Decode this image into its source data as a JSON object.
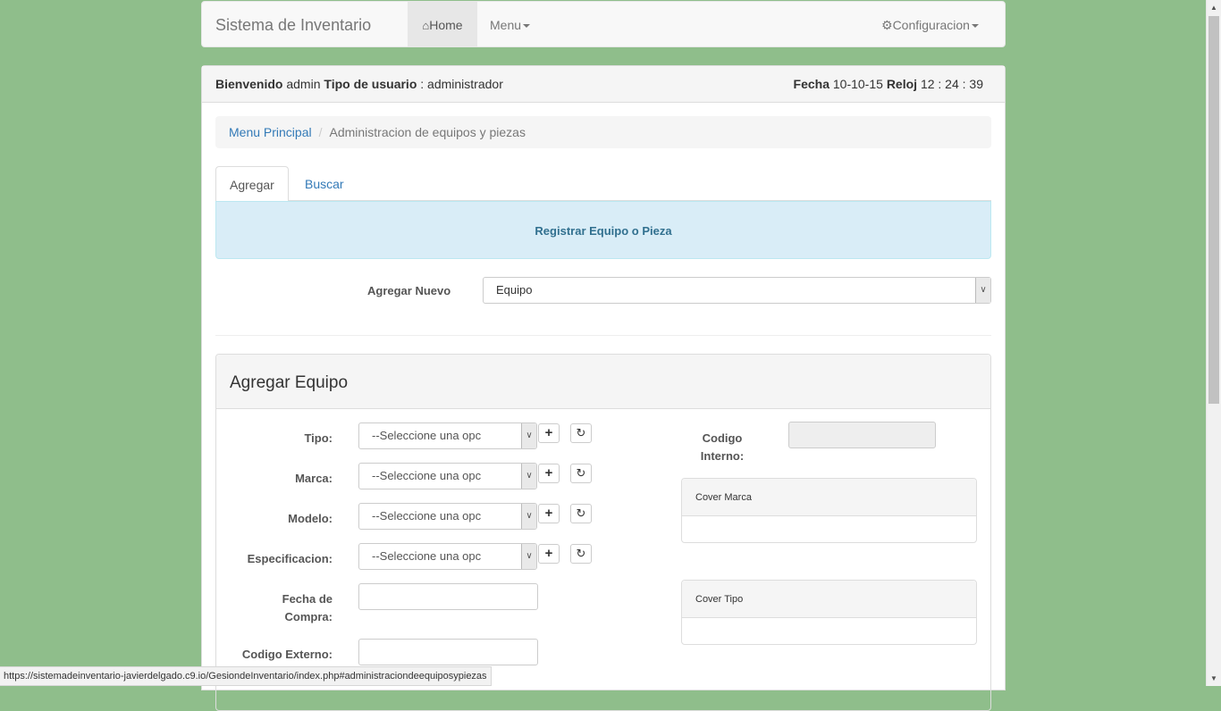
{
  "navbar": {
    "brand": "Sistema de Inventario",
    "home": "Home",
    "menu": "Menu",
    "config": "Configuracion"
  },
  "header": {
    "welcome_label": "Bienvenido",
    "username": "admin",
    "user_type_label": "Tipo de usuario",
    "user_type_sep": ":",
    "user_type": "administrador",
    "date_label": "Fecha",
    "date": "10-10-15",
    "clock_label": "Reloj",
    "clock": "12 : 24 : 39"
  },
  "breadcrumb": {
    "home": "Menu Principal",
    "separator": "/",
    "current": "Administracion de equipos y piezas"
  },
  "tabs": [
    {
      "label": "Agregar",
      "active": true
    },
    {
      "label": "Buscar",
      "active": false
    }
  ],
  "alert": "Registrar Equipo o Pieza",
  "agregar_nuevo": {
    "label": "Agregar Nuevo",
    "value": "Equipo"
  },
  "form": {
    "title": "Agregar Equipo",
    "tipo_label": "Tipo:",
    "marca_label": "Marca:",
    "modelo_label": "Modelo:",
    "especificacion_label": "Especificacion:",
    "fecha_label_1": "Fecha de",
    "fecha_label_2": "Compra:",
    "codigo_externo_label": "Codigo Externo:",
    "select_placeholder": "--Seleccione una opc",
    "codigo_interno_label_1": "Codigo",
    "codigo_interno_label_2": "Interno:",
    "cover_marca": "Cover Marca",
    "cover_tipo": "Cover Tipo",
    "plus_icon": "plus-icon",
    "refresh_icon": "refresh-icon"
  },
  "statusbar": "https://sistemadeinventario-javierdelgado.c9.io/GesiondeInventario/index.php#administraciondeequiposypiezas"
}
